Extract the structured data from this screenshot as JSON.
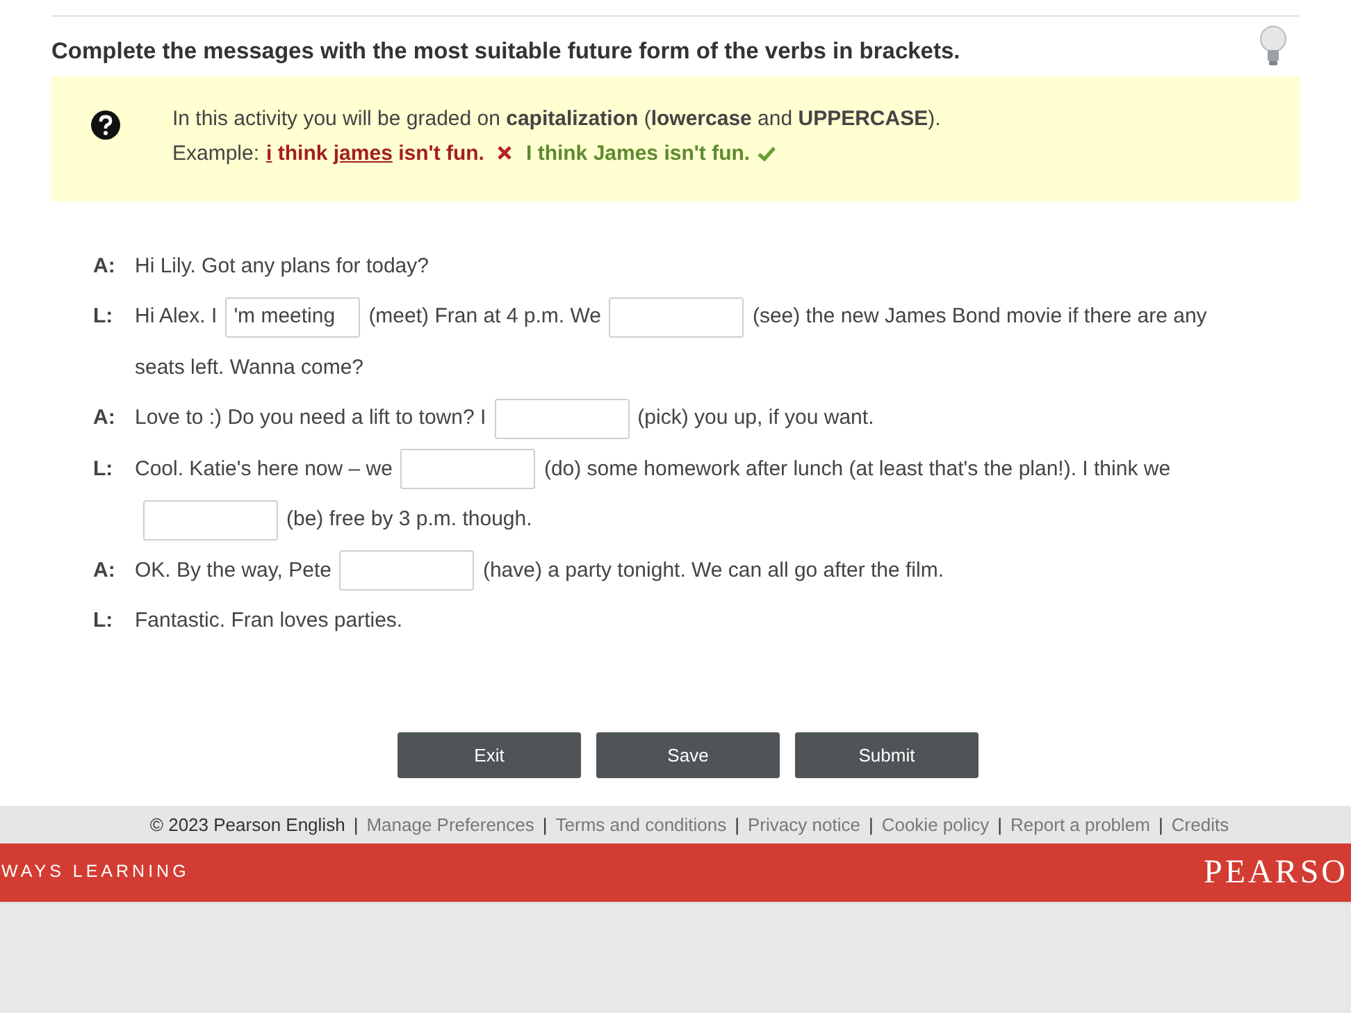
{
  "heading": "Complete the messages with the most suitable future form of the verbs in brackets.",
  "info": {
    "text": "In this activity you will be graded on **capitalization** (**lowercase** and **UPPERCASE**).",
    "example_label": "Example:",
    "wrong": [
      {
        "text": "i",
        "underlined": true
      },
      {
        "text": " think ",
        "underlined": false
      },
      {
        "text": "james",
        "underlined": true
      },
      {
        "text": " isn't fun.",
        "underlined": false
      }
    ],
    "right": "I think James isn't fun."
  },
  "dialogue": [
    {
      "speaker": "A:",
      "parts": [
        {
          "kind": "text",
          "text": "Hi Lily. Got any plans for today?"
        }
      ]
    },
    {
      "speaker": "L:",
      "parts": [
        {
          "kind": "text",
          "text": "Hi Alex. I"
        },
        {
          "kind": "gap",
          "value": "'m meeting"
        },
        {
          "kind": "text",
          "text": "(meet) Fran at 4 p.m. We"
        },
        {
          "kind": "gap"
        },
        {
          "kind": "text",
          "text": "(see) the new James Bond movie if there are any"
        },
        {
          "kind": "text",
          "text": "seats left. Wanna come?"
        }
      ]
    },
    {
      "speaker": "A:",
      "parts": [
        {
          "kind": "text",
          "text": "Love to :) Do you need a lift to town? I"
        },
        {
          "kind": "gap"
        },
        {
          "kind": "text",
          "text": "(pick) you up, if you want."
        }
      ]
    },
    {
      "speaker": "L:",
      "parts": [
        {
          "kind": "text",
          "text": "Cool. Katie's here now – we"
        },
        {
          "kind": "gap"
        },
        {
          "kind": "text",
          "text": "(do) some homework after lunch (at least that's the plan!). I think we"
        },
        {
          "kind": "gap"
        },
        {
          "kind": "text",
          "text": "(be) free by 3 p.m. though."
        }
      ]
    },
    {
      "speaker": "A:",
      "parts": [
        {
          "kind": "text",
          "text": "OK. By the way, Pete"
        },
        {
          "kind": "gap"
        },
        {
          "kind": "text",
          "text": "(have) a party tonight. We can all go after the film."
        }
      ]
    },
    {
      "speaker": "L:",
      "parts": [
        {
          "kind": "text",
          "text": "Fantastic. Fran loves parties."
        }
      ]
    }
  ],
  "buttons": [
    "Exit",
    "Save",
    "Submit"
  ],
  "footer": [
    {
      "kind": "text",
      "text": "© 2023 Pearson English"
    },
    {
      "kind": "separator",
      "text": "|"
    },
    {
      "kind": "link",
      "text": "Manage Preferences"
    },
    {
      "kind": "separator",
      "text": "|"
    },
    {
      "kind": "link",
      "text": "Terms and conditions"
    },
    {
      "kind": "separator",
      "text": "|"
    },
    {
      "kind": "link",
      "text": "Privacy notice"
    },
    {
      "kind": "separator",
      "text": "|"
    },
    {
      "kind": "link",
      "text": "Cookie policy"
    },
    {
      "kind": "separator",
      "text": "|"
    },
    {
      "kind": "link",
      "text": "Report a problem"
    },
    {
      "kind": "separator",
      "text": "|"
    },
    {
      "kind": "link",
      "text": "Credits"
    }
  ],
  "banner": {
    "tagline": "WAYS LEARNING",
    "logo": "PEARSO"
  }
}
